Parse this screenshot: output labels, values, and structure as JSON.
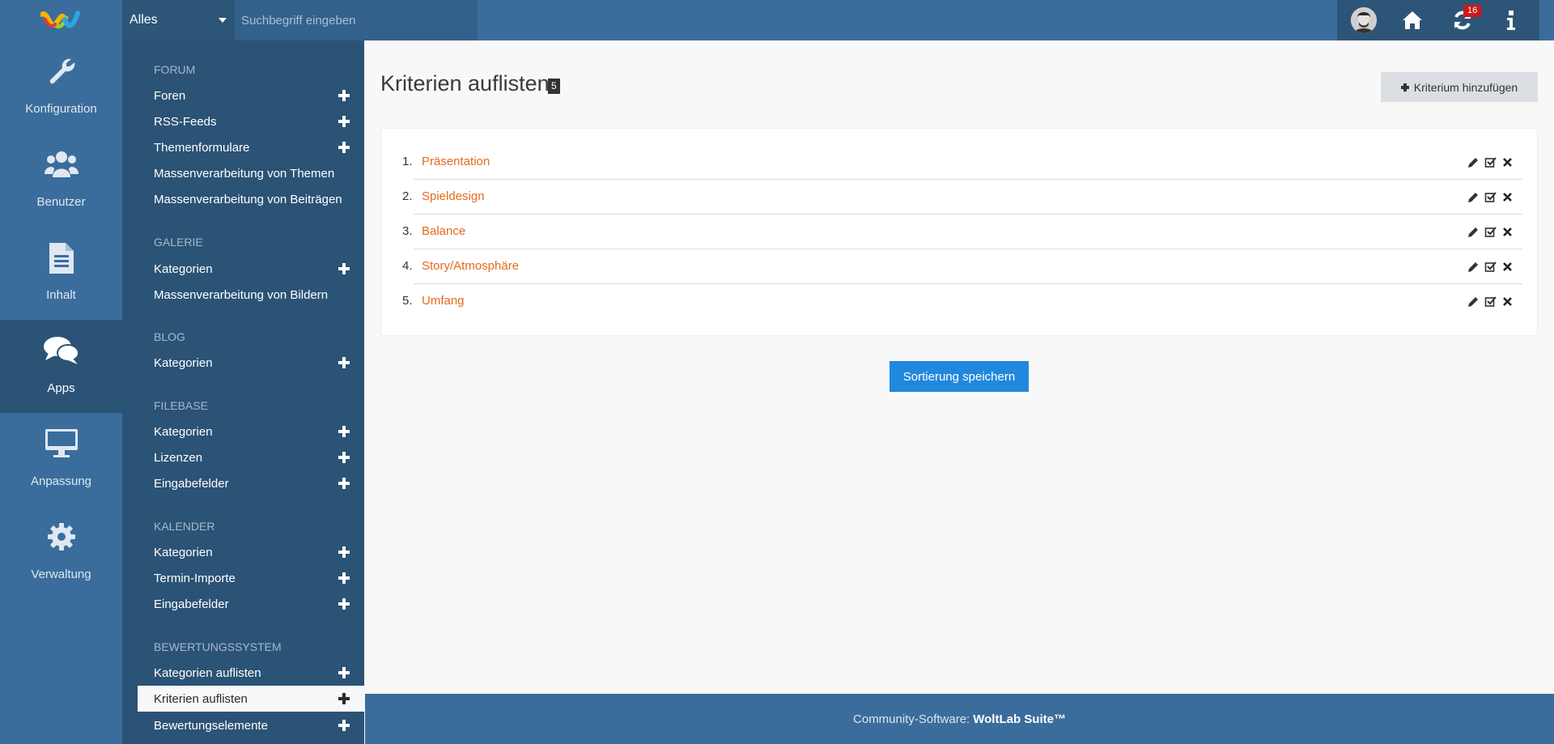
{
  "search": {
    "scope": "Alles",
    "placeholder": "Suchbegriff eingeben"
  },
  "header": {
    "notifications_count": "16"
  },
  "rail": [
    {
      "label": "Konfiguration",
      "icon": "wrench-icon"
    },
    {
      "label": "Benutzer",
      "icon": "users-icon"
    },
    {
      "label": "Inhalt",
      "icon": "document-icon"
    },
    {
      "label": "Apps",
      "icon": "comments-icon",
      "active": true
    },
    {
      "label": "Anpassung",
      "icon": "desktop-icon"
    },
    {
      "label": "Verwaltung",
      "icon": "gear-icon"
    }
  ],
  "menu": {
    "sections": [
      {
        "heading": "Forum",
        "items": [
          "Foren",
          "RSS-Feeds",
          "Themenformulare",
          "Massenverarbeitung von Themen",
          "Massenverarbeitung von Beiträgen"
        ]
      },
      {
        "heading": "Galerie",
        "items": [
          "Kategorien",
          "Massenverarbeitung von Bildern"
        ]
      },
      {
        "heading": "Blog",
        "items": [
          "Kategorien"
        ]
      },
      {
        "heading": "Filebase",
        "items": [
          "Kategorien",
          "Lizenzen",
          "Eingabefelder"
        ]
      },
      {
        "heading": "Kalender",
        "items": [
          "Kategorien",
          "Termin-Importe",
          "Eingabefelder"
        ]
      },
      {
        "heading": "Bewertungssystem",
        "items": [
          "Kategorien auflisten",
          "Kriterien auflisten",
          "Bewertungselemente"
        ]
      }
    ]
  },
  "main": {
    "title": "Kriterien auflisten",
    "count": "5",
    "add_button": "Kriterium hinzufügen",
    "save_button": "Sortierung speichern",
    "items": [
      {
        "num": "1.",
        "name": "Präsentation"
      },
      {
        "num": "2.",
        "name": "Spieldesign"
      },
      {
        "num": "3.",
        "name": "Balance"
      },
      {
        "num": "4.",
        "name": "Story/Atmosphäre"
      },
      {
        "num": "5.",
        "name": "Umfang"
      }
    ]
  },
  "footer": {
    "prefix": "Community-Software:",
    "brand": "WoltLab Suite™"
  },
  "colors": {
    "accent": "#e56a1b",
    "primary": "#2288dd",
    "nav": "#3a6d9c",
    "nav_dark": "#2b5375"
  }
}
